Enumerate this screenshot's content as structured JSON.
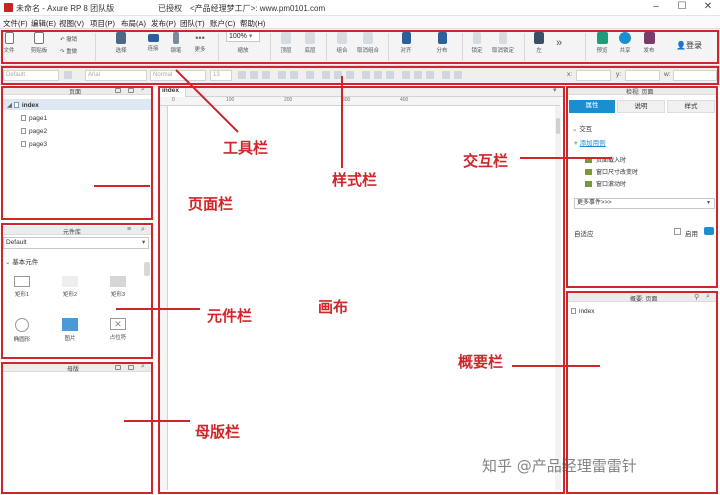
{
  "titlebar": {
    "app_title": "未命名 - Axure RP 8 团队版",
    "license": "已授权",
    "promo": "<产品经理梦工厂>: www.pm0101.com"
  },
  "menu": [
    "文件(F)",
    "编辑(E)",
    "视图(V)",
    "项目(P)",
    "布局(A)",
    "发布(P)",
    "团队(T)",
    "账户(C)",
    "帮助(H)"
  ],
  "toolbar": {
    "file_label": "文件",
    "clipboard_label": "剪贴板",
    "undo_label": "撤销",
    "redo_label": "重做",
    "select_label": "选择",
    "connect_label": "连接",
    "pen_label": "钢笔",
    "more_label": "更多",
    "zoom_value": "100%",
    "zoom_label": "缩放",
    "top_label": "顶层",
    "bottom_label": "底层",
    "group_label": "组合",
    "ungroup_label": "取消组合",
    "align_label": "对齐",
    "distribute_label": "分布",
    "lock_label": "锁定",
    "unlock_label": "取消锁定",
    "left_label": "左",
    "preview_label": "预览",
    "share_label": "共享",
    "publish_label": "发布",
    "login_label": "登录"
  },
  "stylebar": {
    "style_value": "Default",
    "font_value": "Arial",
    "weight_value": "Normal",
    "size_value": "13",
    "x_label": "x:",
    "y_label": "y:",
    "w_label": "w:"
  },
  "pages_panel": {
    "title": "页面",
    "root": "index",
    "children": [
      "page1",
      "page2",
      "page3"
    ]
  },
  "library_panel": {
    "title": "元件库",
    "dropdown": "Default",
    "section": "基本元件",
    "widgets": [
      "矩形1",
      "矩形2",
      "矩形3",
      "椭圆形",
      "图片",
      "占位符"
    ]
  },
  "masters_panel": {
    "title": "母版"
  },
  "canvas": {
    "tab": "index",
    "ruler": [
      "0",
      "100",
      "200",
      "300",
      "400"
    ]
  },
  "inspector": {
    "title": "检视: 页面",
    "tabs": [
      "属性",
      "说明",
      "样式"
    ],
    "section": "交互",
    "add_case": "添加用例",
    "events": [
      "页面载入时",
      "窗口尺寸改变时",
      "窗口滚动时"
    ],
    "more_events": "更多事件>>>",
    "adaptive_label": "自适应",
    "enable_label": "启用"
  },
  "outline_panel": {
    "title": "概要: 页面",
    "item": "index"
  },
  "annotations": {
    "toolbar": "工具栏",
    "style": "样式栏",
    "interaction": "交互栏",
    "pages": "页面栏",
    "library": "元件栏",
    "canvas": "画布",
    "outline": "概要栏",
    "masters": "母版栏"
  },
  "watermark": "知乎 @产品经理雷雷针",
  "colors": {
    "accent": "#1a8fd0",
    "annotation_red": "#d0262b"
  }
}
